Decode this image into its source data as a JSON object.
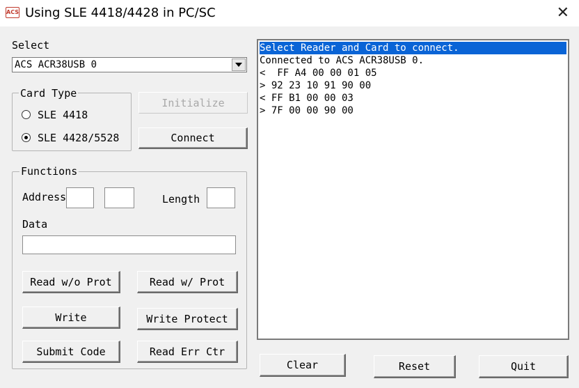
{
  "window": {
    "title": "Using SLE 4418/4428 in PC/SC",
    "icon_text": "ACS",
    "close_glyph": "✕"
  },
  "select": {
    "label": "Select",
    "reader_value": "ACS ACR38USB 0"
  },
  "card_type": {
    "title": "Card Type",
    "options": [
      {
        "label": "SLE 4418",
        "selected": false
      },
      {
        "label": "SLE 4428/5528",
        "selected": true
      }
    ]
  },
  "buttons": {
    "initialize": "Initialize",
    "connect": "Connect",
    "read_wo_prot": "Read w/o Prot",
    "read_w_prot": "Read w/ Prot",
    "write": "Write",
    "write_protect": "Write Protect",
    "submit_code": "Submit Code",
    "read_err_ctr": "Read Err Ctr",
    "clear": "Clear",
    "reset": "Reset",
    "quit": "Quit"
  },
  "functions": {
    "title": "Functions",
    "address_label": "Address:",
    "length_label": "Length",
    "data_label": "Data",
    "address_hi": "",
    "address_lo": "",
    "length": "",
    "data": ""
  },
  "log": {
    "lines": [
      "Select Reader and Card to connect.",
      "Connected to ACS ACR38USB 0.",
      "<  FF A4 00 00 01 05",
      "> 92 23 10 91 90 00",
      "< FF B1 00 00 03",
      "> 7F 00 00 90 00"
    ],
    "selected_index": 0
  }
}
